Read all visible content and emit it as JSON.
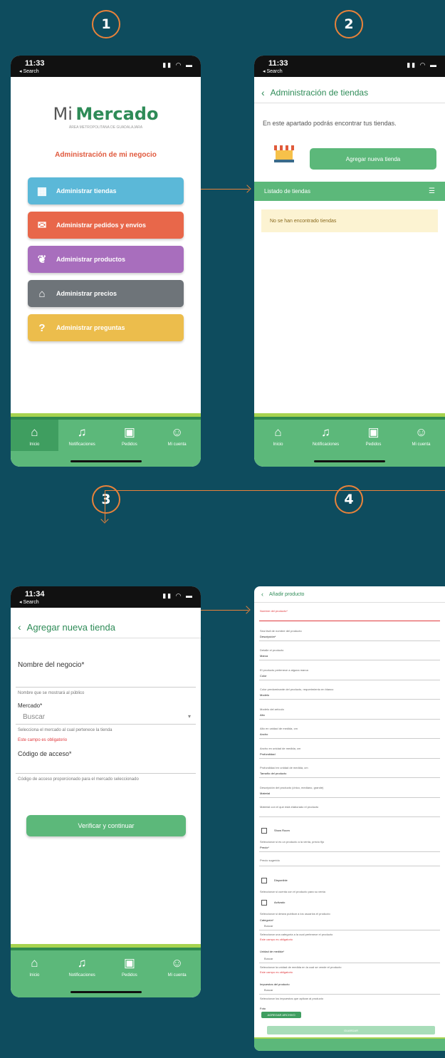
{
  "steps": [
    "1",
    "2",
    "3",
    "4"
  ],
  "status": {
    "time1": "11:33",
    "time2": "11:33",
    "time3": "11:34",
    "search": "◂ Search",
    "icons": "▮▮ ◠ ▬"
  },
  "screen1": {
    "logo_mi": "Mi",
    "logo_mercado": "Mercado",
    "logo_sub": "ÁREA METROPOLITANA DE GUADALAJARA",
    "heading": "Administración de mi negocio",
    "buttons": [
      {
        "label": "Administrar tiendas",
        "color": "#5bb8d8",
        "icon": "store-icon"
      },
      {
        "label": "Administrar pedidos y envíos",
        "color": "#e8674a",
        "icon": "delivery-icon"
      },
      {
        "label": "Administrar productos",
        "color": "#a86ebd",
        "icon": "produce-icon"
      },
      {
        "label": "Administrar precios",
        "color": "#6e7479",
        "icon": "price-tag-icon"
      },
      {
        "label": "Administrar preguntas",
        "color": "#ecbd4c",
        "icon": "question-icon"
      }
    ]
  },
  "tabs": [
    {
      "label": "Inicio",
      "icon": "home-icon"
    },
    {
      "label": "Notificaciones",
      "icon": "bell-icon"
    },
    {
      "label": "Pedidos",
      "icon": "bag-icon"
    },
    {
      "label": "Mi cuenta",
      "icon": "user-icon"
    }
  ],
  "screen2": {
    "title": "Administración de tiendas",
    "intro": "En este apartado podrás encontrar tus tiendas.",
    "add_button": "Agregar nueva tienda",
    "list_title": "Listado de tiendas",
    "empty": "No se han encontrado tiendas"
  },
  "screen3": {
    "title": "Agregar nueva tienda",
    "name_label": "Nombre del negocio*",
    "name_help": "Nombre que se mostrará al público",
    "market_label": "Mercado*",
    "market_placeholder": "Buscar",
    "market_help": "Selecciona el mercado al cual pertenece la tienda",
    "market_error": "Este campo es obligatorio",
    "code_label": "Código de acceso*",
    "code_help": "Código de acceso proporcionado para el mercado seleccionado",
    "submit": "Verificar y continuar"
  },
  "screen4": {
    "title": "Añadir producto",
    "fields": [
      {
        "label": "Nombre del producto*",
        "value": ""
      },
      {
        "label": "Sea fácil de nombre del producto",
        "value": "Descripción*"
      },
      {
        "label": "Detalle el producto",
        "value": "Marca"
      },
      {
        "label": "El producto pertenece a alguna marca",
        "value": "Color"
      },
      {
        "label": "Color predominante del producto, requerimiento en blanco",
        "value": "Modelo"
      },
      {
        "label": "Modelo del artículo",
        "value": "Alto"
      },
      {
        "label": "Alto en unidad de medida, cm",
        "value": "Ancho"
      },
      {
        "label": "Ancho en unidad de medida, cm",
        "value": "Profundidad"
      },
      {
        "label": "Profundidad en unidad de medida, cm",
        "value": "Tamaño del producto"
      },
      {
        "label": "Descripción del producto (chico, mediano, grande)",
        "value": "Material"
      },
      {
        "label": "Material con el que está elaborado el producto",
        "value": ""
      }
    ],
    "showroom": "Show Room",
    "showroom_help": "Seleccionar si es un producto a la venta, precio fijo",
    "precio": "Precio*",
    "precio_sugerido": "Precio sugerido",
    "disponible": "Disponible",
    "disponible_help": "Seleccionar si cuenta con el producto para su venta",
    "activado": "Activado",
    "activado_help": "Seleccionar si desea publicar a los usuarios el producto",
    "categoria": "Categoría*",
    "buscar": "Buscar",
    "categoria_help": "Seleccionar una categoría a la cual pertenece el producto",
    "error": "Este campo es obligatorio",
    "unidad": "Unidad de medida*",
    "unidad_help": "Seleccionar la unidad de medida en la cual se vende el producto",
    "impuestos": "Impuestos del producto",
    "impuestos_help": "Seleccionar los impuestos que aplican al producto",
    "foto": "Foto",
    "upload": "AGREGAR ARCHIVO",
    "save": "GUARDAR"
  }
}
